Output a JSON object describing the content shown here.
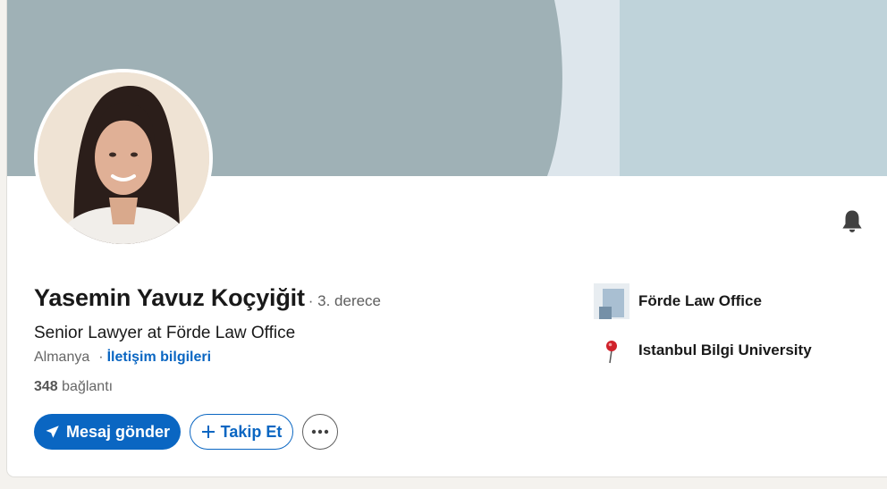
{
  "profile": {
    "name": "Yasemin Yavuz Koçyiğit",
    "degree": "· 3. derece",
    "headline": "Senior Lawyer at Förde Law Office",
    "location": "Almanya",
    "location_separator": "·",
    "contact_link": "İletişim bilgileri",
    "connections_count": "348",
    "connections_label": "bağlantı"
  },
  "actions": {
    "message_label": "Mesaj gönder",
    "follow_label": "Takip Et",
    "more_label": "···"
  },
  "sidebar": {
    "company": "Förde Law Office",
    "school": "Istanbul Bilgi University"
  },
  "icons": {
    "bell": "bell-icon",
    "send": "send-icon",
    "plus": "plus-icon",
    "more": "more-icon"
  },
  "colors": {
    "accent": "#0a66c2",
    "banner_dark": "#9fb1b6",
    "banner_light": "#bfd3da"
  }
}
